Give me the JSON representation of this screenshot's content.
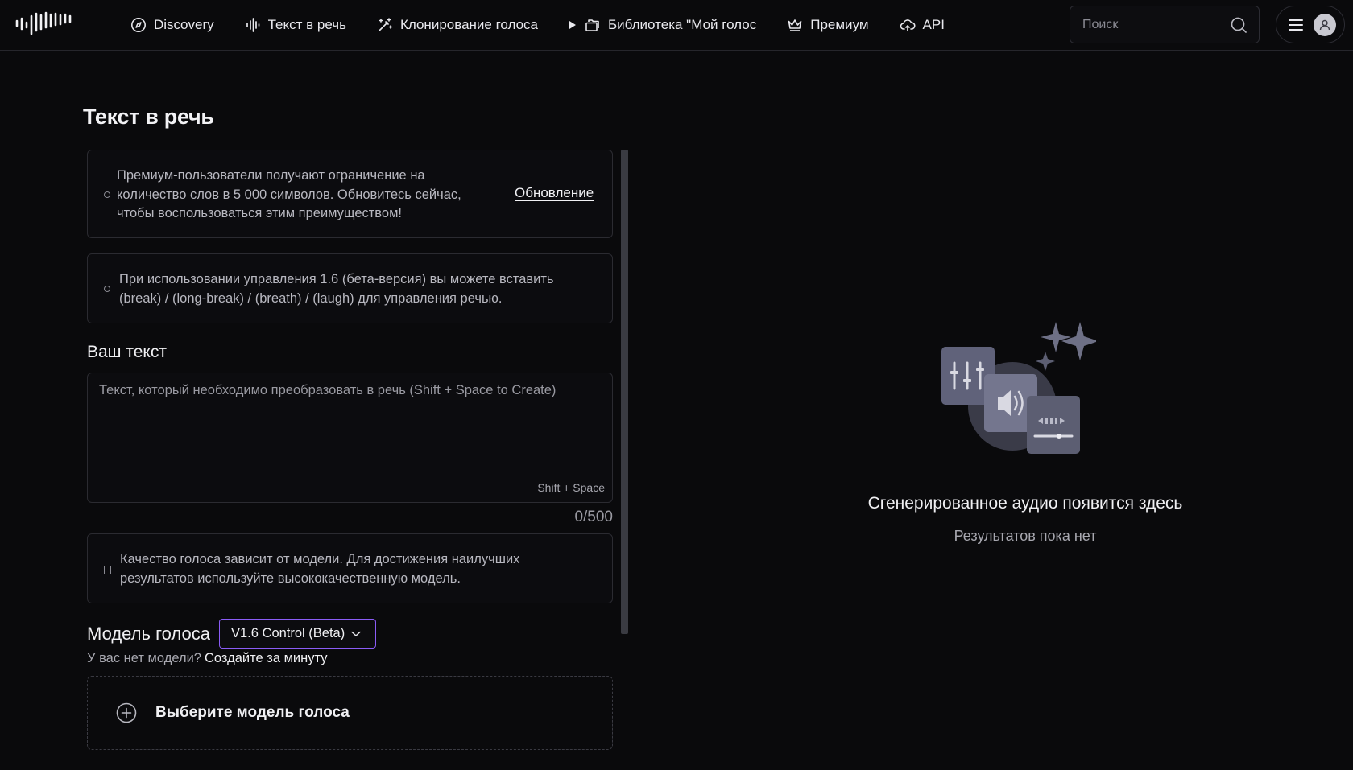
{
  "nav": {
    "items": [
      {
        "label": "Discovery",
        "icon": "compass-icon"
      },
      {
        "label": "Текст в речь",
        "icon": "waveform-icon"
      },
      {
        "label": "Клонирование голоса",
        "icon": "magic-wand-icon"
      },
      {
        "label": "Библиотека \"Мой голос",
        "icon": "folder-icon"
      },
      {
        "label": "Премиум",
        "icon": "crown-icon"
      },
      {
        "label": "API",
        "icon": "cloud-icon"
      }
    ]
  },
  "search": {
    "placeholder": "Поиск"
  },
  "page": {
    "title": "Текст в речь"
  },
  "notices": {
    "premium": "Премиум-пользователи получают ограничение на количество слов в 5 000 символов. Обновитесь сейчас, чтобы воспользоваться этим преимуществом!",
    "upgrade_link": "Обновление",
    "control": "При использовании управления 1.6 (бета-версия) вы можете вставить (break) / (long-break) / (breath) / (laugh) для управления речью.",
    "quality": "Качество голоса зависит от модели. Для достижения наилучших результатов используйте высококачественную модель."
  },
  "editor": {
    "label": "Ваш текст",
    "placeholder": "Текст, который необходимо преобразовать в речь (Shift + Space to Create)",
    "shortcut": "Shift + Space",
    "counter": "0/500"
  },
  "model": {
    "label": "Модель голоса",
    "selected": "V1.6 Control (Beta)",
    "no_model_text": "У вас нет модели?",
    "create_link": "Создайте за минуту",
    "pick_label": "Выберите модель голоса"
  },
  "result": {
    "title": "Сгенерированное аудио появится здесь",
    "subtitle": "Результатов пока нет"
  }
}
